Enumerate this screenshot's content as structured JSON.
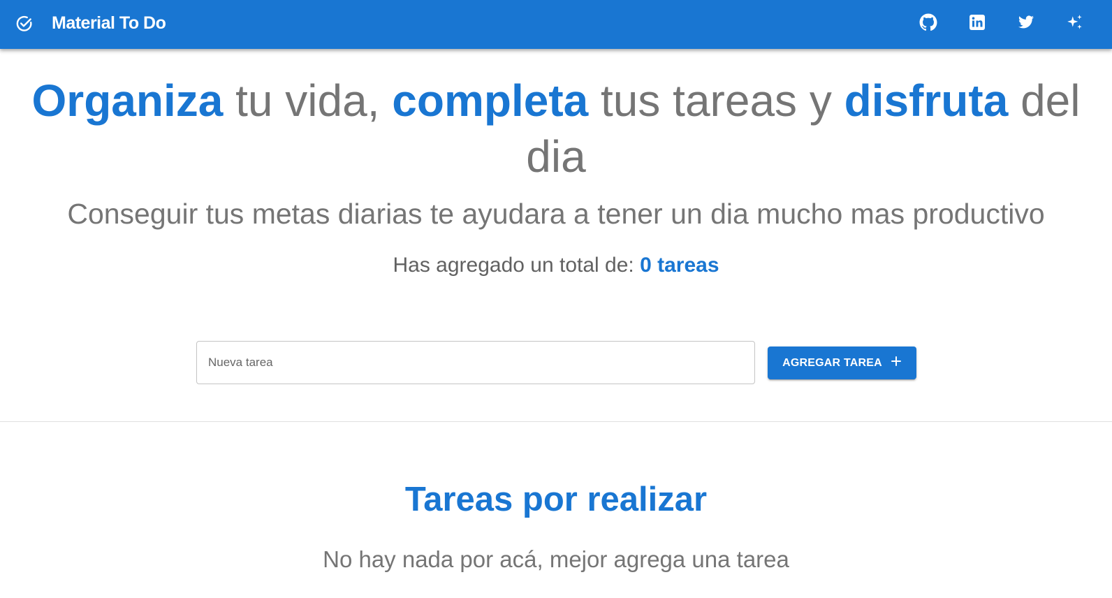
{
  "appbar": {
    "title": "Material To Do",
    "brand_icon": "check-circle-icon",
    "background": "#1976d2",
    "nav_icons": [
      "github-icon",
      "linkedin-icon",
      "twitter-icon",
      "sparkles-icon"
    ]
  },
  "hero": {
    "headline_parts": [
      {
        "text": "Organiza",
        "highlight": true
      },
      {
        "text": " tu vida, ",
        "highlight": false
      },
      {
        "text": "completa",
        "highlight": true
      },
      {
        "text": " tus tareas y ",
        "highlight": false
      },
      {
        "text": "disfruta",
        "highlight": true
      },
      {
        "text": " del dia",
        "highlight": false
      }
    ],
    "subtitle": "Conseguir tus metas diarias te ayudara a tener un dia mucho mas productivo",
    "counter_label": "Has agregado un total de:",
    "counter_value": "0 tareas"
  },
  "form": {
    "input_placeholder": "Nueva tarea",
    "input_value": "",
    "add_button_label": "AGREGAR TAREA"
  },
  "tasks_section": {
    "title": "Tareas por realizar",
    "empty_message": "No hay nada por acá, mejor agrega una tarea"
  },
  "colors": {
    "accent": "#1976d2",
    "text_muted": "#757575"
  }
}
